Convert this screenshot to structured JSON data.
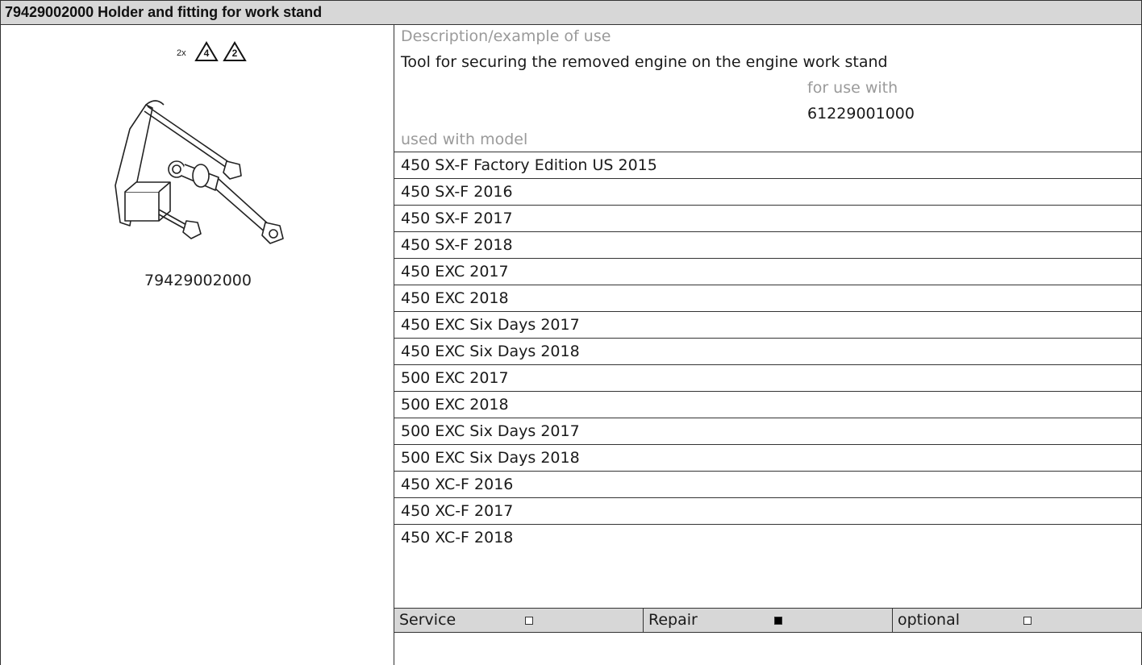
{
  "header": {
    "title": "79429002000 Holder and fitting for work stand"
  },
  "image": {
    "warning_count": "2x",
    "warnings": [
      {
        "label": "4",
        "icon": "warning-triangle-icon"
      },
      {
        "label": "2",
        "icon": "warning-triangle-icon"
      }
    ],
    "illustration": "holder-bolt-illustration",
    "part_number": "79429002000"
  },
  "info": {
    "description_label": "Description/example of use",
    "description_text": "Tool for securing the removed engine on the engine work stand",
    "use_with_label": "for use with",
    "use_with_value": "61229001000",
    "models_label": "used with model",
    "models": [
      "450 SX-F Factory Edition US 2015",
      "450 SX-F 2016",
      "450 SX-F 2017",
      "450 SX-F 2018",
      "450 EXC 2017",
      "450 EXC 2018",
      "450 EXC Six Days 2017",
      "450 EXC Six Days 2018",
      "500 EXC 2017",
      "500 EXC 2018",
      "500 EXC Six Days 2017",
      "500 EXC Six Days 2018",
      "450 XC-F 2016",
      "450 XC-F 2017",
      "450 XC-F 2018"
    ]
  },
  "footer": {
    "items": [
      {
        "label": "Service",
        "checked": false
      },
      {
        "label": "Repair",
        "checked": true
      },
      {
        "label": "optional",
        "checked": false
      }
    ]
  },
  "colors": {
    "header_bg": "#d7d7d7",
    "muted_text": "#9a9a9a",
    "border": "#333333"
  }
}
